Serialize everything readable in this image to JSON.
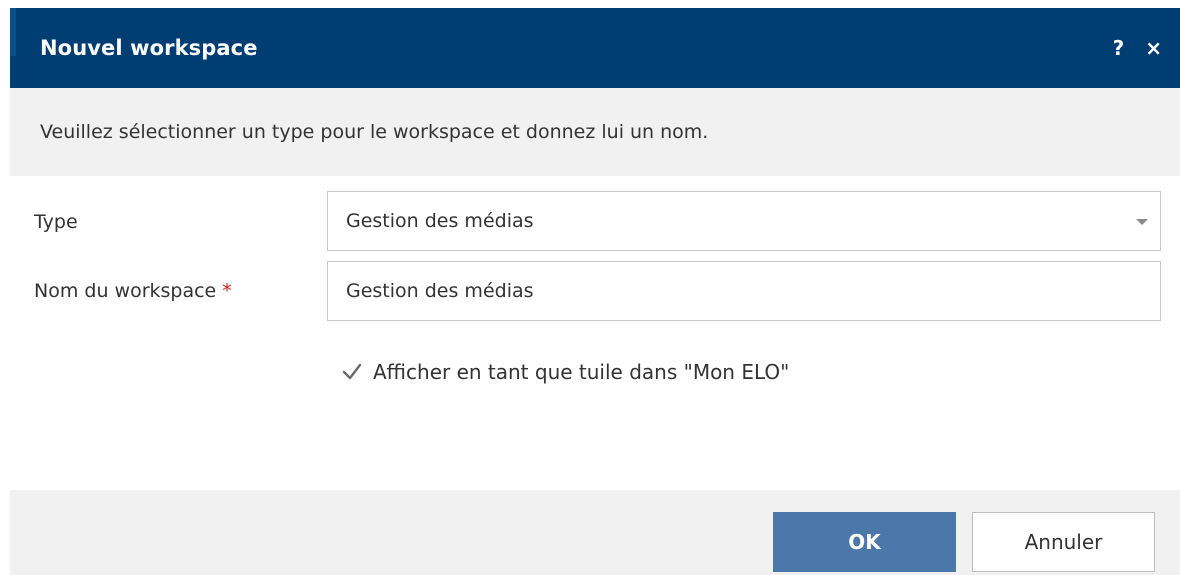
{
  "dialog": {
    "title": "Nouvel workspace",
    "help_icon": "?",
    "close_icon": "×",
    "instruction": "Veuillez sélectionner un type pour le workspace et donnez lui un nom."
  },
  "form": {
    "type_label": "Type",
    "type_value": "Gestion des médias",
    "name_label": "Nom du workspace",
    "required_marker": "*",
    "name_value": "Gestion des médias",
    "checkbox_label": "Afficher en tant que tuile dans \"Mon ELO\"",
    "checkbox_checked": true
  },
  "buttons": {
    "ok_label": "OK",
    "cancel_label": "Annuler"
  },
  "colors": {
    "titlebar": "#003d73",
    "ok_button": "#4b77a9",
    "required": "#cc1f1f"
  }
}
